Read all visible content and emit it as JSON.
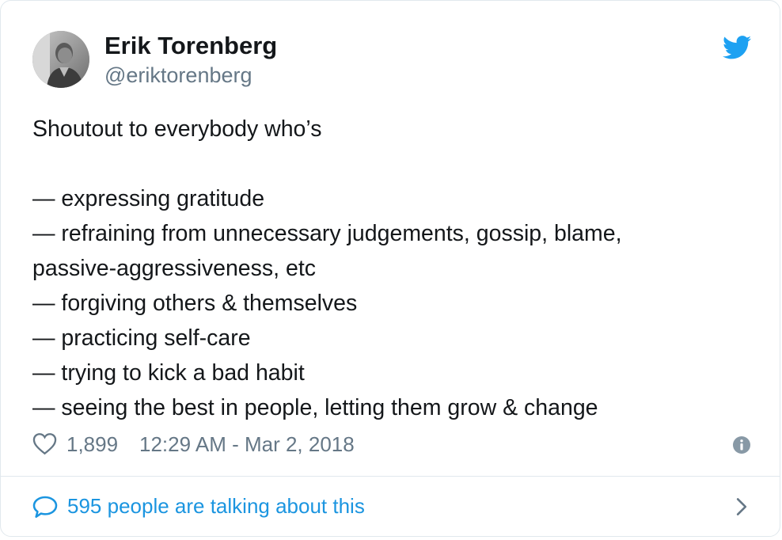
{
  "author": {
    "name": "Erik Torenberg",
    "handle": "@eriktorenberg",
    "avatar": "avatar-photo"
  },
  "tweet": {
    "lines": [
      "Shoutout to everybody who’s",
      "",
      "— expressing gratitude",
      "— refraining from unnecessary judgements, gossip, blame,",
      "passive-aggressiveness, etc",
      "— forgiving others & themselves",
      "— practicing self-care",
      "— trying to kick a bad habit",
      "— seeing the best in people, letting them grow & change"
    ]
  },
  "meta": {
    "likes": "1,899",
    "timestamp": "12:29 AM - Mar 2, 2018"
  },
  "footer": {
    "conversation_text": "595 people are talking about this"
  },
  "icons": {
    "brand": "twitter-bird-icon",
    "like": "heart-icon",
    "info": "info-icon",
    "reply": "speech-bubble-icon",
    "more": "chevron-right-icon"
  },
  "colors": {
    "brand_blue": "#1da1f2",
    "link_blue": "#1b95e0",
    "text_primary": "#14171a",
    "text_secondary": "#657786",
    "border": "#e1e8ed"
  }
}
